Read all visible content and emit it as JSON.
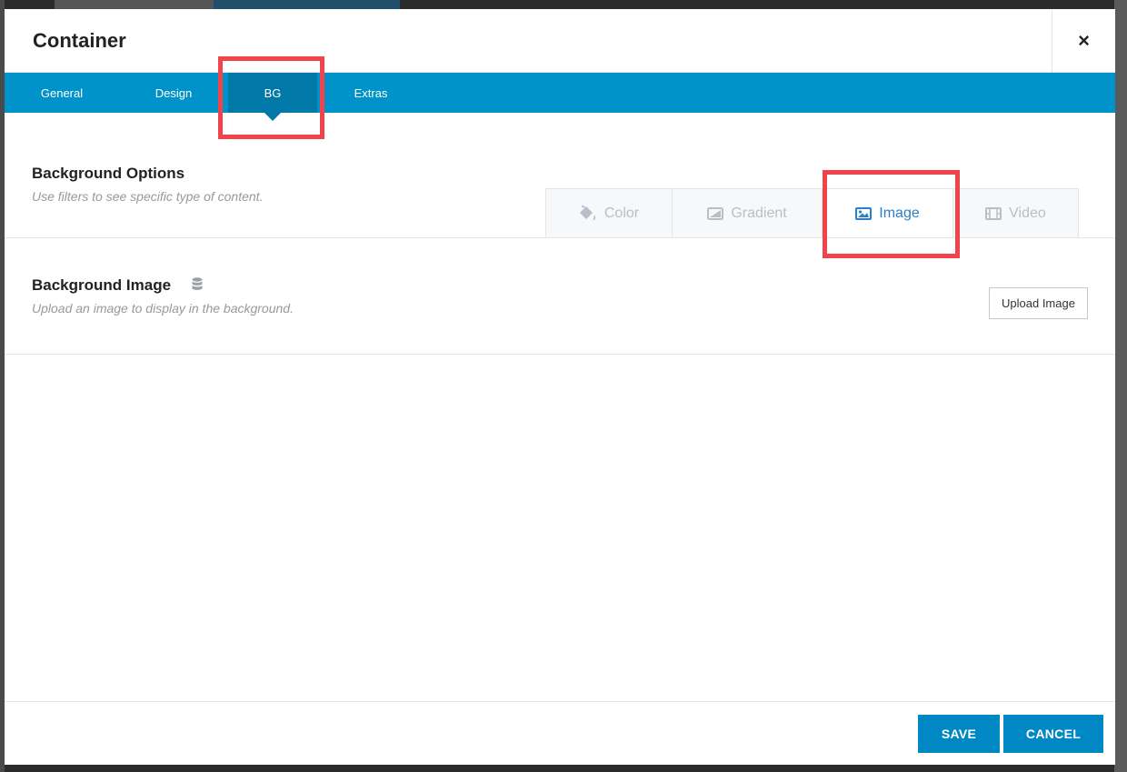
{
  "modal": {
    "title": "Container",
    "close_label": "×"
  },
  "tabs": [
    {
      "label": "General"
    },
    {
      "label": "Design"
    },
    {
      "label": "BG"
    },
    {
      "label": "Extras"
    }
  ],
  "active_tab": "BG",
  "background_options": {
    "title": "Background Options",
    "description": "Use filters to see specific type of content.",
    "filters": [
      {
        "label": "Color",
        "icon": "paint-bucket-icon"
      },
      {
        "label": "Gradient",
        "icon": "gradient-icon"
      },
      {
        "label": "Image",
        "icon": "image-icon"
      },
      {
        "label": "Video",
        "icon": "film-icon"
      }
    ],
    "active_filter": "Image"
  },
  "background_image": {
    "title": "Background Image",
    "description": "Upload an image to display in the background.",
    "icon": "database-icon",
    "upload_label": "Upload Image"
  },
  "footer": {
    "save_label": "SAVE",
    "cancel_label": "CANCEL"
  },
  "colors": {
    "tab_bar": "#0093c9",
    "tab_active": "#0079a8",
    "highlight": "#f0434a",
    "active_filter_text": "#2a7fc6",
    "button": "#0088c4"
  }
}
